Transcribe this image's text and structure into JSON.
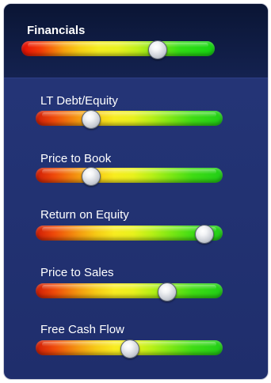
{
  "header": {
    "title": "Financials",
    "level": 0.72
  },
  "metrics": [
    {
      "label": "LT Debt/Equity",
      "level": 0.27
    },
    {
      "label": "Price to Book",
      "level": 0.27
    },
    {
      "label": "Return on Equity",
      "level": 0.94
    },
    {
      "label": "Price to Sales",
      "level": 0.72
    },
    {
      "label": "Free Cash Flow",
      "level": 0.5
    }
  ],
  "colors": {
    "panel": "#1f2e6c",
    "header": "#0a1534",
    "scale_low": "#cf1d07",
    "scale_mid": "#f8ec20",
    "scale_high": "#1fcf17"
  },
  "icons": {
    "knob": "slider-knob-icon"
  }
}
